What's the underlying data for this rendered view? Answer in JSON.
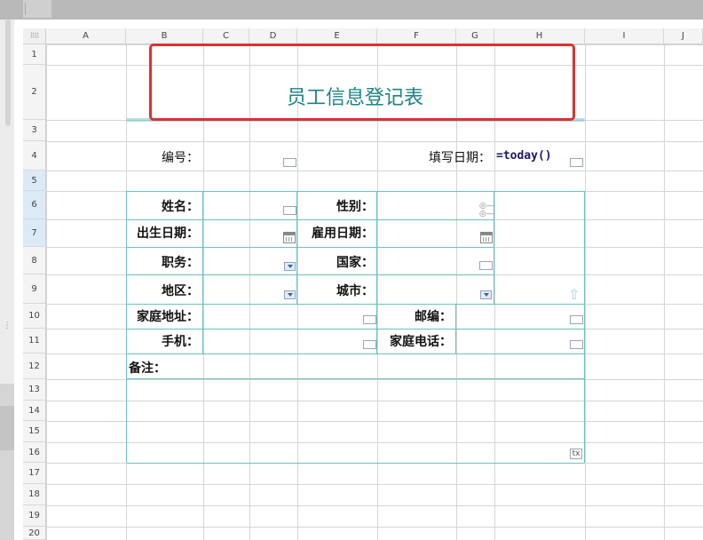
{
  "columns": [
    "A",
    "B",
    "C",
    "D",
    "E",
    "F",
    "G",
    "H",
    "I",
    "J"
  ],
  "rows": [
    "1",
    "2",
    "3",
    "4",
    "5",
    "6",
    "7",
    "8",
    "9",
    "10",
    "11",
    "12",
    "13",
    "14",
    "15",
    "16",
    "17",
    "18",
    "19",
    "20"
  ],
  "selected_rows": [
    "5",
    "6",
    "7"
  ],
  "form": {
    "title": "员工信息登记表",
    "number_label": "编号：",
    "date_label": "填写日期：",
    "date_formula": "=today()",
    "name_label": "姓名：",
    "gender_label": "性别：",
    "birth_label": "出生日期：",
    "hire_label": "雇用日期：",
    "position_label": "职务：",
    "country_label": "国家：",
    "region_label": "地区：",
    "city_label": "城市：",
    "address_label": "家庭地址：",
    "zip_label": "邮编：",
    "mobile_label": "手机：",
    "home_phone_label": "家庭电话：",
    "notes_label": "备注：",
    "notes_control": "tx"
  },
  "colors": {
    "accent": "#1b8585",
    "highlight": "#e03030",
    "grid": "#d5d5d5",
    "table_border": "#6cc0c0"
  },
  "icons": [
    "calendar-icon",
    "dropdown-arrow-icon",
    "radio-option-icon",
    "upload-arrow-icon",
    "text-control-icon",
    "select-all-icon"
  ]
}
